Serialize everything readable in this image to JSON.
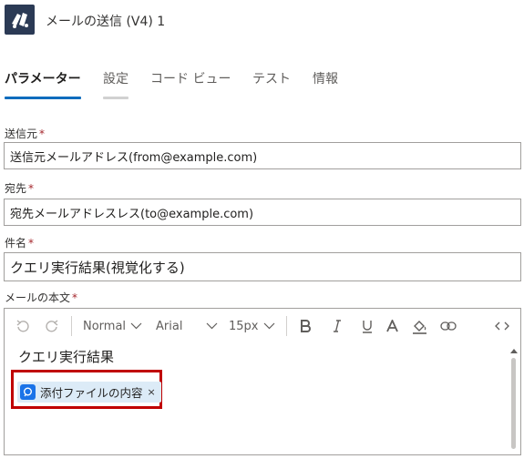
{
  "header": {
    "app_icon": "mail-connector-icon",
    "title": "メールの送信 (V4) 1"
  },
  "tabs": [
    {
      "label": "パラメーター",
      "state": "active"
    },
    {
      "label": "設定",
      "state": "hover"
    },
    {
      "label": "コード ビュー",
      "state": "normal"
    },
    {
      "label": "テスト",
      "state": "normal"
    },
    {
      "label": "情報",
      "state": "normal"
    }
  ],
  "form": {
    "required_mark": "*",
    "from": {
      "label": "送信元",
      "value": "送信元メールアドレス(from@example.com)"
    },
    "to": {
      "label": "宛先",
      "value": "宛先メールアドレスレス(to@example.com)"
    },
    "subject": {
      "label": "件名",
      "value": "クエリ実行結果(視覚化する)"
    },
    "body": {
      "label": "メールの本文",
      "toolbar": {
        "undo_icon": "undo-icon",
        "redo_icon": "redo-icon",
        "format": "Normal",
        "font": "Arial",
        "size": "15px",
        "bold_icon": "bold-icon",
        "italic_icon": "italic-icon",
        "underline_icon": "underline-icon",
        "font_color_icon": "font-color-icon",
        "highlight_icon": "paint-bucket-icon",
        "link_icon": "link-icon",
        "code_view_icon": "code-view-icon"
      },
      "text": "クエリ実行結果",
      "token": {
        "label": "添付ファイルの内容",
        "remove": "×",
        "icon": "dynamic-content-icon"
      }
    }
  },
  "colors": {
    "accent": "#0f6cbd",
    "required": "#a4262c",
    "highlight_box": "#c00000",
    "token_bg": "#dcebf7",
    "app_icon_bg": "#2b3a55"
  }
}
